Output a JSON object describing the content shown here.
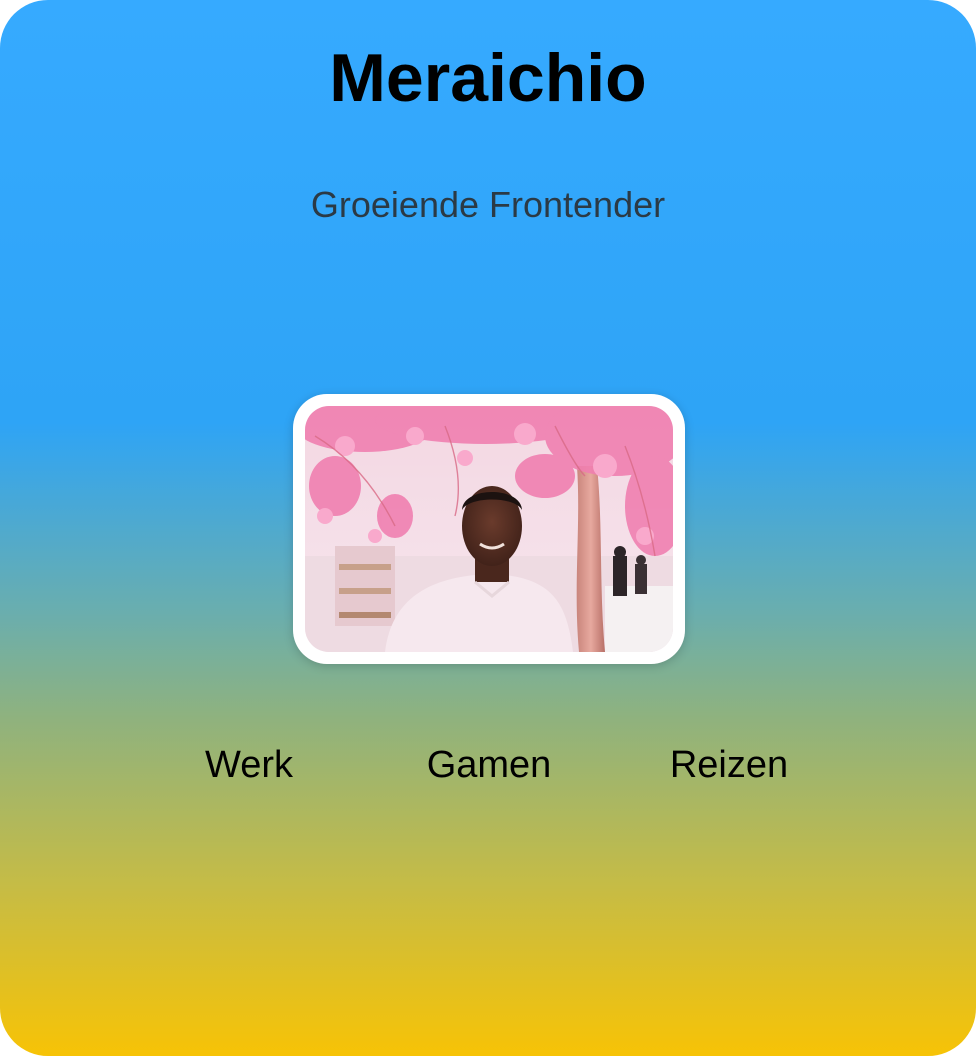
{
  "profile": {
    "name": "Meraichio",
    "tagline": "Groeiende Frontender"
  },
  "photo": {
    "subject": "portrait-photo"
  },
  "nav": {
    "items": [
      {
        "label": "Werk"
      },
      {
        "label": "Gamen"
      },
      {
        "label": "Reizen"
      }
    ]
  },
  "colors": {
    "gradient_top": "#36aaff",
    "gradient_bottom": "#f7c306",
    "title": "#000000",
    "subtitle": "#2b3a45"
  }
}
